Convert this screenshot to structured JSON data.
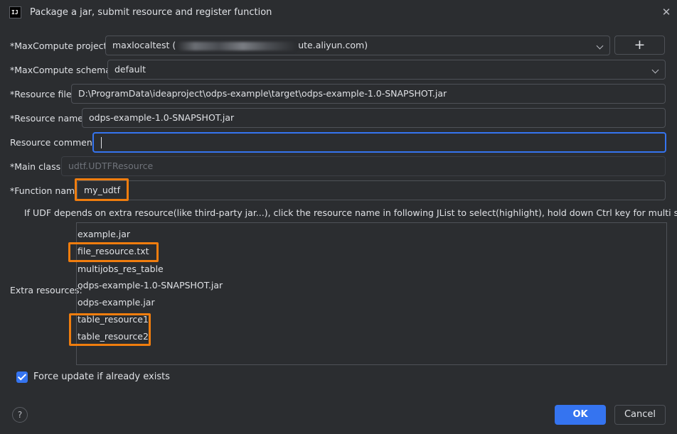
{
  "window": {
    "title": "Package a jar, submit resource and register function",
    "icon_text": "IJ",
    "close_glyph": "✕"
  },
  "form": {
    "project": {
      "label": "*MaxCompute project:",
      "value_prefix": "maxlocaltest (",
      "value_suffix": "ute.aliyun.com)",
      "add_glyph": "+"
    },
    "schema": {
      "label": "*MaxCompute schema:",
      "value": "default"
    },
    "resource_file": {
      "label": "*Resource file:",
      "value": "D:\\ProgramData\\ideaproject\\odps-example\\target\\odps-example-1.0-SNAPSHOT.jar"
    },
    "resource_name": {
      "label": "*Resource name:",
      "value": "odps-example-1.0-SNAPSHOT.jar"
    },
    "resource_comment": {
      "label": "Resource comment:",
      "value": ""
    },
    "main_class": {
      "label": "*Main class:",
      "value": "udtf.UDTFResource"
    },
    "function_name": {
      "label": "*Function name:",
      "value": "my_udtf"
    }
  },
  "hint": "If UDF depends on extra resource(like third-party jar...), click the resource name in following JList to select(highlight), hold down Ctrl key for multi select.",
  "extra_resources": {
    "label": "Extra resources:",
    "items": [
      "example.jar",
      "file_resource.txt",
      "multijobs_res_table",
      "odps-example-1.0-SNAPSHOT.jar",
      "odps-example.jar",
      "table_resource1",
      "table_resource2"
    ]
  },
  "force_update": {
    "label": "Force update if already exists",
    "checked": true
  },
  "footer": {
    "help": "?",
    "ok": "OK",
    "cancel": "Cancel"
  },
  "colors": {
    "background": "#2b2d30",
    "accent": "#3574f0",
    "highlight": "#f07d0e",
    "border": "#4e5157"
  }
}
